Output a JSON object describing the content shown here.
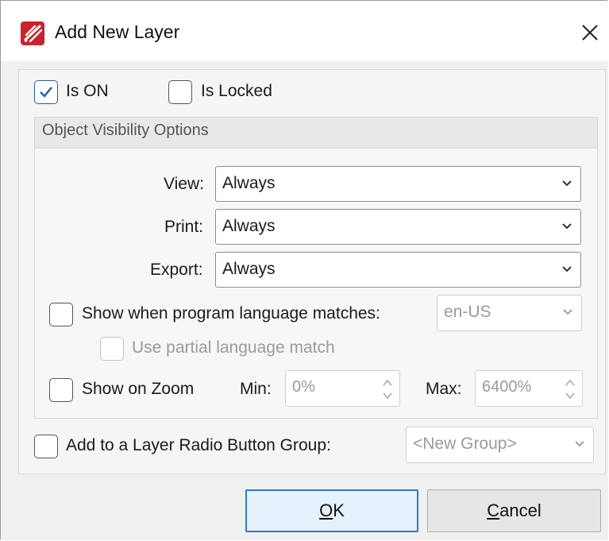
{
  "dialog": {
    "title": "Add New Layer",
    "close_icon": "close-icon",
    "app_icon": "pdf-editor-logo-icon"
  },
  "options": {
    "is_on": {
      "label": "Is ON",
      "checked": true
    },
    "is_locked": {
      "label": "Is Locked",
      "checked": false
    }
  },
  "visibility": {
    "group_title": "Object Visibility Options",
    "view": {
      "label": "View:",
      "value": "Always"
    },
    "print": {
      "label": "Print:",
      "value": "Always"
    },
    "export": {
      "label": "Export:",
      "value": "Always"
    },
    "language": {
      "label": "Show when program language matches:",
      "checked": false,
      "value": "en-US",
      "partial_label": "Use partial language match",
      "partial_checked": false
    },
    "zoom": {
      "label": "Show on Zoom",
      "checked": false,
      "min_label": "Min:",
      "min_value": "0%",
      "max_label": "Max:",
      "max_value": "6400%"
    }
  },
  "radio_group": {
    "label": "Add to a Layer Radio Button Group:",
    "checked": false,
    "value": "<New Group>"
  },
  "buttons": {
    "ok_mnemonic": "O",
    "ok_rest": "K",
    "cancel_mnemonic": "C",
    "cancel_rest": "ancel"
  },
  "colors": {
    "accent": "#2b79d6",
    "check": "#1f5fa8",
    "logo_red": "#c8232c"
  }
}
